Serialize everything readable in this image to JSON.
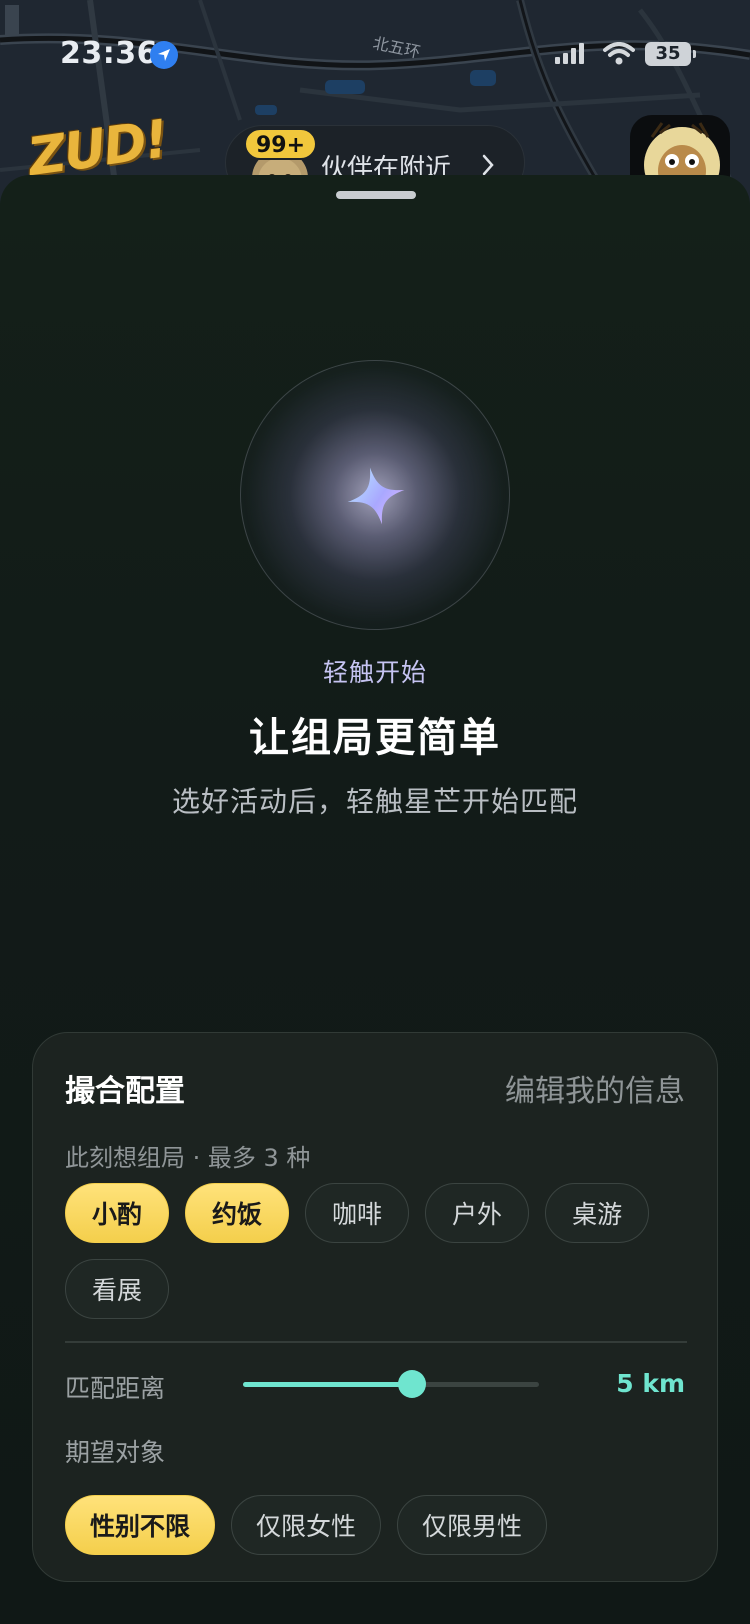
{
  "status_bar": {
    "time": "23:36",
    "battery": "35",
    "icons": [
      "location-arrow-icon",
      "cellular-signal-icon",
      "wifi-icon",
      "battery-icon"
    ]
  },
  "map": {
    "road_label": "北五环"
  },
  "header": {
    "logo_text": "ZUD!",
    "nearby": {
      "badge": "99+",
      "label": "伙伴在附近",
      "chevron": "chevron-right-icon"
    },
    "profile_avatar": "deer-avatar"
  },
  "hero": {
    "sparkle_icon": "sparkle-icon",
    "tap_label": "轻触开始",
    "headline": "让组局更简单",
    "subline": "选好活动后，轻触星芒开始匹配"
  },
  "config": {
    "title": "撮合配置",
    "edit_link": "编辑我的信息",
    "activity_caption": "此刻想组局 · 最多 3 种",
    "activities": [
      {
        "label": "小酌",
        "selected": true
      },
      {
        "label": "约饭",
        "selected": true
      },
      {
        "label": "咖啡",
        "selected": false
      },
      {
        "label": "户外",
        "selected": false
      },
      {
        "label": "桌游",
        "selected": false
      },
      {
        "label": "看展",
        "selected": false
      }
    ],
    "distance_label": "匹配距离",
    "distance_value": "5 km",
    "distance_fraction": 0.57,
    "target_label": "期望对象",
    "targets": [
      {
        "label": "性别不限",
        "selected": true
      },
      {
        "label": "仅限女性",
        "selected": false
      },
      {
        "label": "仅限男性",
        "selected": false
      }
    ]
  },
  "colors": {
    "accent_yellow": "#f4cf4c",
    "accent_teal": "#6fe5cf",
    "sheet_bg": "#121b18",
    "sparkle_purple": "#c6c4f2"
  }
}
